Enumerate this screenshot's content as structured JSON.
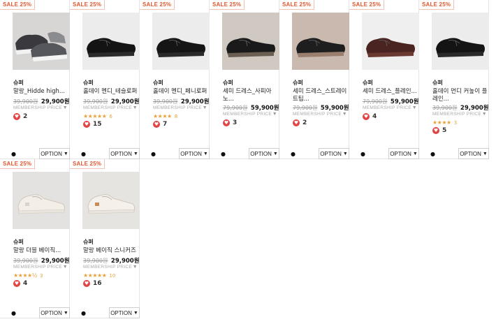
{
  "products": [
    {
      "sale": "SALE 25%",
      "brand": "슈퍼",
      "title": "말랑_Hidde high...",
      "orig": "39,900원",
      "price": "29,900원",
      "member": "MEMBERSHIP PRICE",
      "stars": "",
      "rating_count": "",
      "likes": "2",
      "option": "OPTION",
      "img_bg": "#d8d6d4",
      "shoe": "#3a3a3e",
      "accent": "#f2f2f2"
    },
    {
      "sale": "SALE 25%",
      "brand": "슈퍼",
      "title": "홀데이 멘디_테슬로퍼",
      "orig": "39,900원",
      "price": "29,900원",
      "member": "MEMBERSHIP PRICE",
      "stars": "★★★★★",
      "rating_count": "6",
      "likes": "15",
      "option": "OPTION",
      "img_bg": "#ececec",
      "shoe": "#141414",
      "accent": "#2b2b2b"
    },
    {
      "sale": "SALE 25%",
      "brand": "슈퍼",
      "title": "홀데이 멘디_페니로퍼",
      "orig": "39,900원",
      "price": "29,900원",
      "member": "MEMBERSHIP PRICE",
      "stars": "★★★★",
      "rating_count": "8",
      "likes": "7",
      "option": "OPTION",
      "img_bg": "#ececec",
      "shoe": "#151515",
      "accent": "#2a2a2a"
    },
    {
      "sale": "SALE 25%",
      "brand": "슈퍼",
      "title": "세미 드레스_사피아노...",
      "orig": "79,900원",
      "price": "59,900원",
      "member": "MEMBERSHIP PRICE",
      "stars": "",
      "rating_count": "",
      "likes": "3",
      "option": "OPTION",
      "img_bg": "#cfc9c2",
      "shoe": "#1a1a1a",
      "accent": "#6b5e52"
    },
    {
      "sale": "SALE 25%",
      "brand": "슈퍼",
      "title": "세미 드레스_스트레이트팁...",
      "orig": "79,900원",
      "price": "59,900원",
      "member": "MEMBERSHIP PRICE",
      "stars": "",
      "rating_count": "",
      "likes": "2",
      "option": "OPTION",
      "img_bg": "#c9b9ae",
      "shoe": "#1e1e1e",
      "accent": "#9a7f6f"
    },
    {
      "sale": "SALE 25%",
      "brand": "슈퍼",
      "title": "세미 드레스_플레인...",
      "orig": "79,900원",
      "price": "59,900원",
      "member": "MEMBERSHIP PRICE",
      "stars": "",
      "rating_count": "",
      "likes": "4",
      "option": "OPTION",
      "img_bg": "#efefef",
      "shoe": "#4a2420",
      "accent": "#6a3a32"
    },
    {
      "sale": "SALE 25%",
      "brand": "슈퍼",
      "title": "홀데이 먼디 커높이 플레인...",
      "orig": "39,900원",
      "price": "29,900원",
      "member": "MEMBERSHIP PRICE",
      "stars": "★★★★",
      "rating_count": "3",
      "likes": "5",
      "option": "OPTION",
      "img_bg": "#ececec",
      "shoe": "#141414",
      "accent": "#2a2a2a"
    },
    {
      "sale": "SALE 25%",
      "brand": "슈퍼",
      "title": "말랑 더블 베이직...",
      "orig": "39,900원",
      "price": "29,900원",
      "member": "MEMBERSHIP PRICE",
      "stars": "★★★★½",
      "rating_count": "3",
      "likes": "4",
      "option": "OPTION",
      "img_bg": "#e4e2e0",
      "shoe": "#f3efe8",
      "accent": "#d9d3ca"
    },
    {
      "sale": "SALE 25%",
      "brand": "슈퍼",
      "title": "말랑 베이직 스니커즈",
      "orig": "39,900원",
      "price": "29,900원",
      "member": "MEMBERSHIP PRICE",
      "stars": "★★★★★",
      "rating_count": "10",
      "likes": "16",
      "option": "OPTION",
      "img_bg": "#e6e4e1",
      "shoe": "#f5f1ea",
      "accent": "#c98b55"
    }
  ]
}
